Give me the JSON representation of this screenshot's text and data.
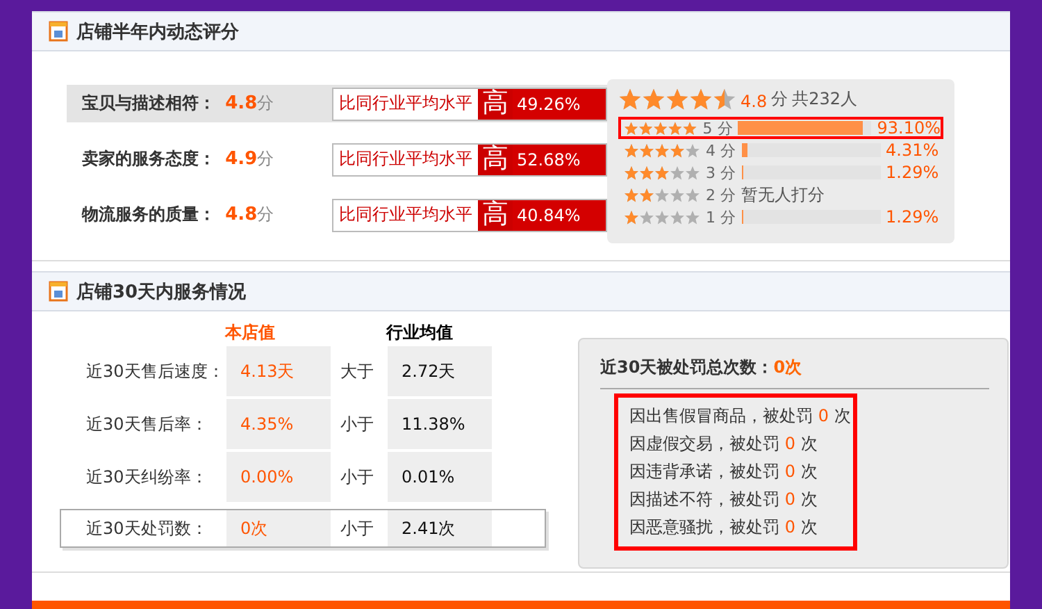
{
  "rating_section": {
    "title": "店铺半年内动态评分",
    "ratings": [
      {
        "label": "宝贝与描述相符：",
        "score": "4.8",
        "unit": "分",
        "compare_text": "比同行业平均水平",
        "grade": "高",
        "percent": "49.26%",
        "selected": true
      },
      {
        "label": "卖家的服务态度：",
        "score": "4.9",
        "unit": "分",
        "compare_text": "比同行业平均水平",
        "grade": "高",
        "percent": "52.68%",
        "selected": false
      },
      {
        "label": "物流服务的质量：",
        "score": "4.8",
        "unit": "分",
        "compare_text": "比同行业平均水平",
        "grade": "高",
        "percent": "40.84%",
        "selected": false
      }
    ],
    "summary": {
      "stars": 4.5,
      "score": "4.8",
      "unit": "分",
      "total": "共232人"
    },
    "distribution": [
      {
        "kind": "bar",
        "stars": 5,
        "label": "5 分",
        "level": 0.931,
        "value": "93.10%",
        "highlighted": true
      },
      {
        "kind": "bar",
        "stars": 4,
        "label": "4 分",
        "level": 0.043,
        "value": "4.31%",
        "highlighted": false
      },
      {
        "kind": "bar",
        "stars": 3,
        "label": "3 分",
        "level": 0.013,
        "value": "1.29%",
        "highlighted": false
      },
      {
        "kind": "text",
        "stars": 2,
        "label": "2 分",
        "value": "暂无人打分",
        "highlighted": false
      },
      {
        "kind": "bar",
        "stars": 1,
        "label": "1 分",
        "level": 0.013,
        "value": "1.29%",
        "highlighted": false
      }
    ]
  },
  "service_section": {
    "title": "店铺30天内服务情况",
    "columns": [
      "本店值",
      "行业均值"
    ],
    "rows": [
      {
        "label": "近30天售后速度：",
        "shop": "4.13天",
        "compare": "大于",
        "industry": "2.72天",
        "selected": false
      },
      {
        "label": "近30天售后率：",
        "shop": "4.35%",
        "compare": "小于",
        "industry": "11.38%",
        "selected": false
      },
      {
        "label": "近30天纠纷率：",
        "shop": "0.00%",
        "compare": "小于",
        "industry": "0.01%",
        "selected": false
      },
      {
        "label": "近30天处罚数：",
        "shop": "0次",
        "compare": "小于",
        "industry": "2.41次",
        "selected": true
      }
    ],
    "penalty": {
      "title": "近30天被处罚总次数：",
      "count": "0次",
      "highlighted": true,
      "items": [
        {
          "text": "因出售假冒商品，被处罚",
          "count": "0",
          "unit": "次"
        },
        {
          "text": "因虚假交易，被处罚",
          "count": "0",
          "unit": "次"
        },
        {
          "text": "因违背承诺，被处罚",
          "count": "0",
          "unit": "次"
        },
        {
          "text": "因描述不符，被处罚",
          "count": "0",
          "unit": "次"
        },
        {
          "text": "因恶意骚扰，被处罚",
          "count": "0",
          "unit": "次"
        }
      ]
    }
  }
}
